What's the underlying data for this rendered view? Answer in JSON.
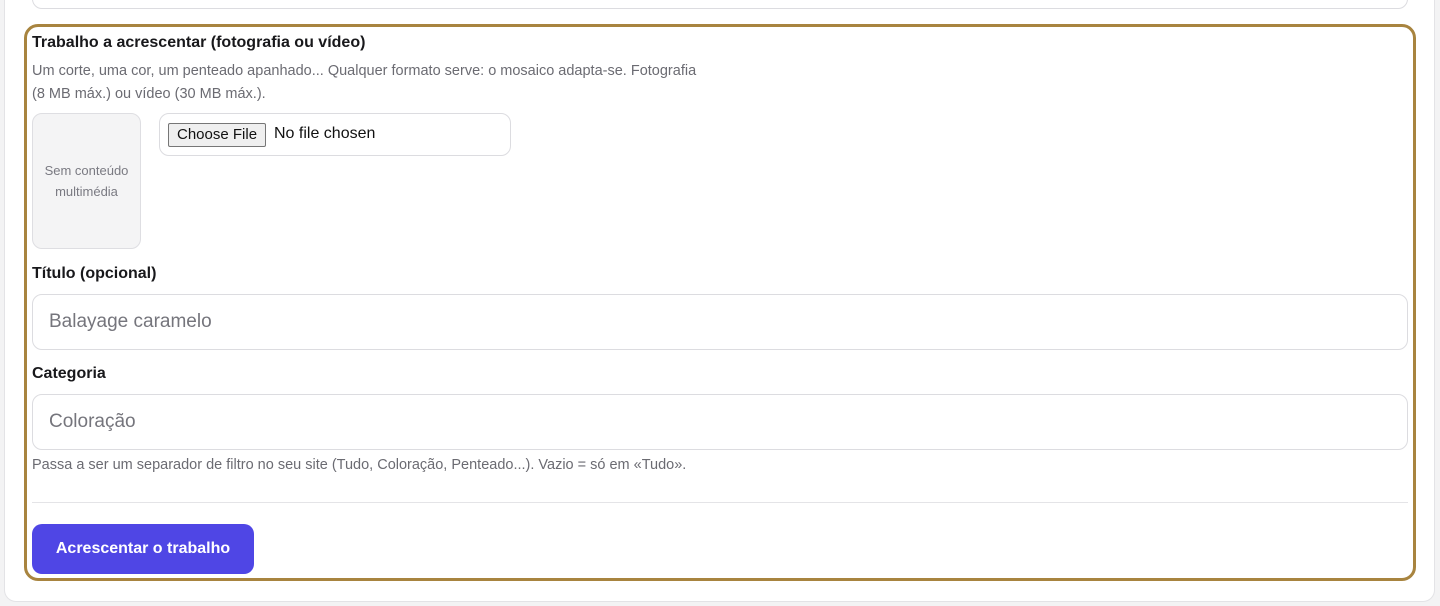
{
  "upload": {
    "label": "Trabalho a acrescentar (fotografia ou vídeo)",
    "help_line1": "Um corte, uma cor, um penteado apanhado... Qualquer formato serve: o mosaico adapta-se. Fotografia",
    "help_line2": "(8 MB máx.) ou vídeo (30 MB máx.).",
    "preview_empty": "Sem conteúdo multimédia",
    "choose_file_label": "Choose File",
    "file_status": "No file chosen"
  },
  "title_field": {
    "label": "Título (opcional)",
    "placeholder": "Balayage caramelo"
  },
  "category_field": {
    "label": "Categoria",
    "placeholder": "Coloração",
    "help": "Passa a ser um separador de filtro no seu site (Tudo, Coloração, Penteado...). Vazio = só em «Tudo»."
  },
  "submit": {
    "label": "Acrescentar o trabalho",
    "color": "#4f46e5"
  },
  "colors": {
    "frame_accent": "#a8843f"
  }
}
